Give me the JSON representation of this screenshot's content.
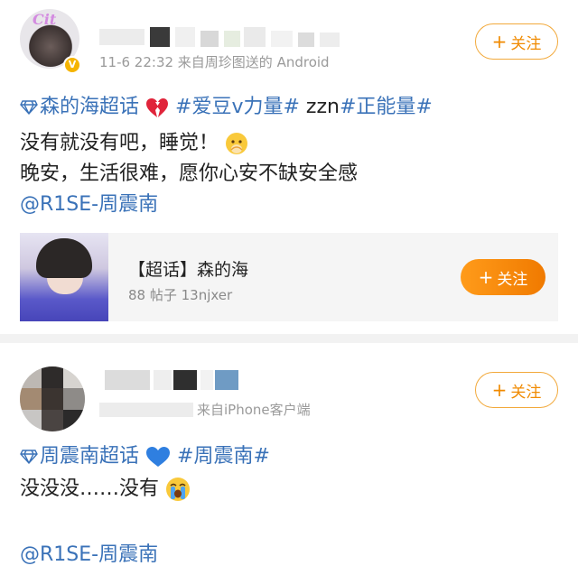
{
  "post1": {
    "avatar_logo": "Cit",
    "meta_text": "11-6 22:32  来自周珍图送的 Android",
    "follow_label": "关注",
    "line1": {
      "supertopic": "森的海超话",
      "tag1": "#爱豆v力量#",
      "plain": " zzn",
      "tag2": "#正能量#"
    },
    "line2": "没有就没有吧，睡觉！",
    "line3": "晚安，生活很难，愿你心安不缺安全感",
    "mention": "@R1SE-周震南",
    "card": {
      "title": "【超话】森的海",
      "sub": "88 帖子 13njxer",
      "follow_label": "关注"
    }
  },
  "post2": {
    "meta_text": "来自iPhone客户端",
    "follow_label": "关注",
    "line1": {
      "supertopic": "周震南超话",
      "tag": "#周震南#"
    },
    "line2": "没没没……没有",
    "mention": "@R1SE-周震南"
  },
  "colors": {
    "link": "#3a72b8",
    "follow_orange": "#f08a00",
    "verify_gold": "#f5b400",
    "meta_gray": "#9a9a9a"
  },
  "icons": {
    "supertopic": "diamond-icon",
    "broken_heart": "broken-heart-icon",
    "blue_heart": "blue-heart-icon",
    "cold_face": "cold-face-emoji-icon",
    "crying_face": "crying-face-emoji-icon",
    "verified": "verified-badge-icon",
    "plus": "plus-icon"
  }
}
